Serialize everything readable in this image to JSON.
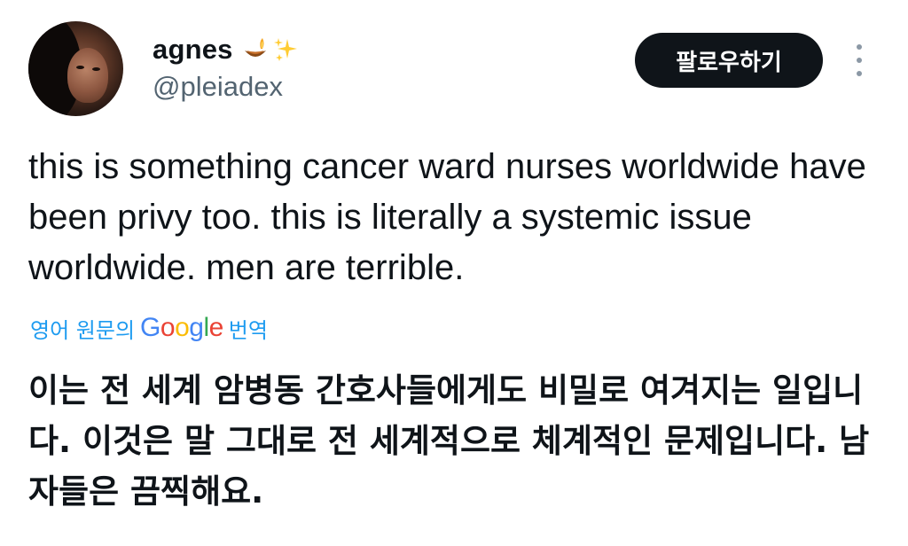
{
  "author": {
    "display_name": "agnes",
    "emojis": [
      "diya-lamp",
      "sparkles"
    ],
    "handle": "@pleiadex"
  },
  "follow_button": {
    "label": "팔로우하기"
  },
  "tweet": {
    "text": "this is something cancer ward nurses worldwide have been privy too. this is literally a systemic issue worldwide. men are terrible."
  },
  "translation": {
    "prefix": "영어 원문의",
    "logo_text": "Google",
    "suffix": "번역",
    "text": "이는 전 세계 암병동 간호사들에게도 비밀로 여겨지는 일입니다. 이것은 말 그대로 전 세계적으로 체계적인 문제입니다. 남자들은 끔찍해요."
  },
  "colors": {
    "text_primary": "#0f1419",
    "text_secondary": "#536471",
    "link_blue": "#1d9bf0",
    "button_bg": "#0f1419",
    "button_text": "#ffffff"
  }
}
